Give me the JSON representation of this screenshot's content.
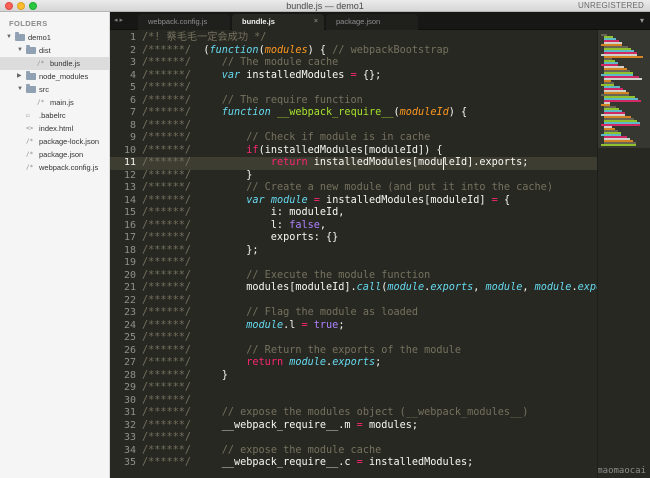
{
  "window": {
    "title": "bundle.js — demo1",
    "status": "UNREGISTERED"
  },
  "sidebar": {
    "heading": "FOLDERS",
    "items": [
      {
        "label": "demo1",
        "type": "folder",
        "expanded": true,
        "depth": 0
      },
      {
        "label": "dist",
        "type": "folder",
        "expanded": true,
        "depth": 1
      },
      {
        "label": "bundle.js",
        "type": "file",
        "depth": 2,
        "selected": true,
        "icon": "/*"
      },
      {
        "label": "node_modules",
        "type": "folder",
        "expanded": false,
        "depth": 1
      },
      {
        "label": "src",
        "type": "folder",
        "expanded": true,
        "depth": 1
      },
      {
        "label": "main.js",
        "type": "file",
        "depth": 2,
        "icon": "/*"
      },
      {
        "label": ".babelrc",
        "type": "file",
        "depth": 1,
        "icon": "▭"
      },
      {
        "label": "index.html",
        "type": "file",
        "depth": 1,
        "icon": "<>"
      },
      {
        "label": "package-lock.json",
        "type": "file",
        "depth": 1,
        "icon": "/*"
      },
      {
        "label": "package.json",
        "type": "file",
        "depth": 1,
        "icon": "/*"
      },
      {
        "label": "webpack.config.js",
        "type": "file",
        "depth": 1,
        "icon": "/*"
      }
    ]
  },
  "tabs": [
    {
      "label": "webpack.config.js",
      "active": false
    },
    {
      "label": "bundle.js",
      "active": true
    },
    {
      "label": "package.json",
      "active": false
    }
  ],
  "tab_nav": "◂ ▸",
  "tab_close_glyph": "×",
  "tab_dropdown": "▾",
  "editor": {
    "current_line": 11,
    "lines": [
      {
        "n": "1",
        "tokens": [
          [
            "c-com",
            "/*! 蔡毛毛一定会成功 */"
          ]
        ]
      },
      {
        "n": "2",
        "tokens": [
          [
            "c-com",
            "/******/ "
          ],
          [
            "c-pl",
            " ("
          ],
          [
            "c-st",
            "function"
          ],
          [
            "c-pl",
            "("
          ],
          [
            "c-par",
            "modules"
          ],
          [
            "c-pl",
            ") { "
          ],
          [
            "c-com",
            "// webpackBootstrap"
          ]
        ]
      },
      {
        "n": "3",
        "tokens": [
          [
            "c-com",
            "/******/ "
          ],
          [
            "c-pl",
            "    "
          ],
          [
            "c-com",
            "// The module cache"
          ]
        ]
      },
      {
        "n": "4",
        "tokens": [
          [
            "c-com",
            "/******/ "
          ],
          [
            "c-pl",
            "    "
          ],
          [
            "c-st",
            "var"
          ],
          [
            "c-pl",
            " installedModules "
          ],
          [
            "c-kw",
            "="
          ],
          [
            "c-pl",
            " {};"
          ]
        ]
      },
      {
        "n": "5",
        "tokens": [
          [
            "c-com",
            "/******/"
          ]
        ]
      },
      {
        "n": "6",
        "tokens": [
          [
            "c-com",
            "/******/ "
          ],
          [
            "c-pl",
            "    "
          ],
          [
            "c-com",
            "// The require function"
          ]
        ]
      },
      {
        "n": "7",
        "tokens": [
          [
            "c-com",
            "/******/ "
          ],
          [
            "c-pl",
            "    "
          ],
          [
            "c-st",
            "function"
          ],
          [
            "c-pl",
            " "
          ],
          [
            "c-fn",
            "__webpack_require__"
          ],
          [
            "c-pl",
            "("
          ],
          [
            "c-par",
            "moduleId"
          ],
          [
            "c-pl",
            ") {"
          ]
        ]
      },
      {
        "n": "8",
        "tokens": [
          [
            "c-com",
            "/******/"
          ]
        ]
      },
      {
        "n": "9",
        "tokens": [
          [
            "c-com",
            "/******/ "
          ],
          [
            "c-pl",
            "        "
          ],
          [
            "c-com",
            "// Check if module is in cache"
          ]
        ]
      },
      {
        "n": "10",
        "tokens": [
          [
            "c-com",
            "/******/ "
          ],
          [
            "c-pl",
            "        "
          ],
          [
            "c-kw",
            "if"
          ],
          [
            "c-pl",
            "(installedModules[moduleId]) {"
          ]
        ]
      },
      {
        "n": "11",
        "tokens": [
          [
            "c-com",
            "/******/ "
          ],
          [
            "c-pl",
            "            "
          ],
          [
            "c-kw",
            "return"
          ],
          [
            "c-pl",
            " installedModules[moduleId].exports;"
          ]
        ]
      },
      {
        "n": "12",
        "tokens": [
          [
            "c-com",
            "/******/ "
          ],
          [
            "c-pl",
            "        }"
          ]
        ]
      },
      {
        "n": "13",
        "tokens": [
          [
            "c-com",
            "/******/ "
          ],
          [
            "c-pl",
            "        "
          ],
          [
            "c-com",
            "// Create a new module (and put it into the cache)"
          ]
        ]
      },
      {
        "n": "14",
        "tokens": [
          [
            "c-com",
            "/******/ "
          ],
          [
            "c-pl",
            "        "
          ],
          [
            "c-st",
            "var"
          ],
          [
            "c-pl",
            " "
          ],
          [
            "c-it",
            "module"
          ],
          [
            "c-pl",
            " "
          ],
          [
            "c-kw",
            "="
          ],
          [
            "c-pl",
            " installedModules[moduleId] "
          ],
          [
            "c-kw",
            "="
          ],
          [
            "c-pl",
            " {"
          ]
        ]
      },
      {
        "n": "15",
        "tokens": [
          [
            "c-com",
            "/******/ "
          ],
          [
            "c-pl",
            "            i: moduleId,"
          ]
        ]
      },
      {
        "n": "16",
        "tokens": [
          [
            "c-com",
            "/******/ "
          ],
          [
            "c-pl",
            "            l: "
          ],
          [
            "c-num",
            "false"
          ],
          [
            "c-pl",
            ","
          ]
        ]
      },
      {
        "n": "17",
        "tokens": [
          [
            "c-com",
            "/******/ "
          ],
          [
            "c-pl",
            "            exports: {}"
          ]
        ]
      },
      {
        "n": "18",
        "tokens": [
          [
            "c-com",
            "/******/ "
          ],
          [
            "c-pl",
            "        };"
          ]
        ]
      },
      {
        "n": "19",
        "tokens": [
          [
            "c-com",
            "/******/"
          ]
        ]
      },
      {
        "n": "20",
        "tokens": [
          [
            "c-com",
            "/******/ "
          ],
          [
            "c-pl",
            "        "
          ],
          [
            "c-com",
            "// Execute the module function"
          ]
        ]
      },
      {
        "n": "21",
        "tokens": [
          [
            "c-com",
            "/******/ "
          ],
          [
            "c-pl",
            "        modules[moduleId]."
          ],
          [
            "c-it",
            "call"
          ],
          [
            "c-pl",
            "("
          ],
          [
            "c-it",
            "module"
          ],
          [
            "c-pl",
            "."
          ],
          [
            "c-it",
            "exports"
          ],
          [
            "c-pl",
            ", "
          ],
          [
            "c-it",
            "module"
          ],
          [
            "c-pl",
            ", "
          ],
          [
            "c-it",
            "module"
          ],
          [
            "c-pl",
            "."
          ],
          [
            "c-it",
            "exports"
          ],
          [
            "c-pl",
            ", __webpack_require__);"
          ]
        ]
      },
      {
        "n": "22",
        "tokens": [
          [
            "c-com",
            "/******/"
          ]
        ]
      },
      {
        "n": "23",
        "tokens": [
          [
            "c-com",
            "/******/ "
          ],
          [
            "c-pl",
            "        "
          ],
          [
            "c-com",
            "// Flag the module as loaded"
          ]
        ]
      },
      {
        "n": "24",
        "tokens": [
          [
            "c-com",
            "/******/ "
          ],
          [
            "c-pl",
            "        "
          ],
          [
            "c-it",
            "module"
          ],
          [
            "c-pl",
            ".l "
          ],
          [
            "c-kw",
            "="
          ],
          [
            "c-pl",
            " "
          ],
          [
            "c-num",
            "true"
          ],
          [
            "c-pl",
            ";"
          ]
        ]
      },
      {
        "n": "25",
        "tokens": [
          [
            "c-com",
            "/******/"
          ]
        ]
      },
      {
        "n": "26",
        "tokens": [
          [
            "c-com",
            "/******/ "
          ],
          [
            "c-pl",
            "        "
          ],
          [
            "c-com",
            "// Return the exports of the module"
          ]
        ]
      },
      {
        "n": "27",
        "tokens": [
          [
            "c-com",
            "/******/ "
          ],
          [
            "c-pl",
            "        "
          ],
          [
            "c-kw",
            "return"
          ],
          [
            "c-pl",
            " "
          ],
          [
            "c-it",
            "module"
          ],
          [
            "c-pl",
            "."
          ],
          [
            "c-it",
            "exports"
          ],
          [
            "c-pl",
            ";"
          ]
        ]
      },
      {
        "n": "28",
        "tokens": [
          [
            "c-com",
            "/******/ "
          ],
          [
            "c-pl",
            "    }"
          ]
        ]
      },
      {
        "n": "29",
        "tokens": [
          [
            "c-com",
            "/******/"
          ]
        ]
      },
      {
        "n": "30",
        "tokens": [
          [
            "c-com",
            "/******/"
          ]
        ]
      },
      {
        "n": "31",
        "tokens": [
          [
            "c-com",
            "/******/ "
          ],
          [
            "c-pl",
            "    "
          ],
          [
            "c-com",
            "// expose the modules object (__webpack_modules__)"
          ]
        ]
      },
      {
        "n": "32",
        "tokens": [
          [
            "c-com",
            "/******/ "
          ],
          [
            "c-pl",
            "    __webpack_require__.m "
          ],
          [
            "c-kw",
            "="
          ],
          [
            "c-pl",
            " modules;"
          ]
        ]
      },
      {
        "n": "33",
        "tokens": [
          [
            "c-com",
            "/******/"
          ]
        ]
      },
      {
        "n": "34",
        "tokens": [
          [
            "c-com",
            "/******/ "
          ],
          [
            "c-pl",
            "    "
          ],
          [
            "c-com",
            "// expose the module cache"
          ]
        ]
      },
      {
        "n": "35",
        "tokens": [
          [
            "c-com",
            "/******/ "
          ],
          [
            "c-pl",
            "    __webpack_require__.c "
          ],
          [
            "c-kw",
            "="
          ],
          [
            "c-pl",
            " installedModules;"
          ]
        ]
      }
    ]
  },
  "watermark": "https://blog.csdn.net/caimaomaocai",
  "colors": {
    "editor_bg": "#272822",
    "comment": "#75715e",
    "keyword": "#f92672",
    "storage": "#66d9ef",
    "function": "#a6e22e",
    "parameter": "#fd971f",
    "constant": "#ae81ff",
    "sidebar_bg": "#f5f5f5"
  }
}
